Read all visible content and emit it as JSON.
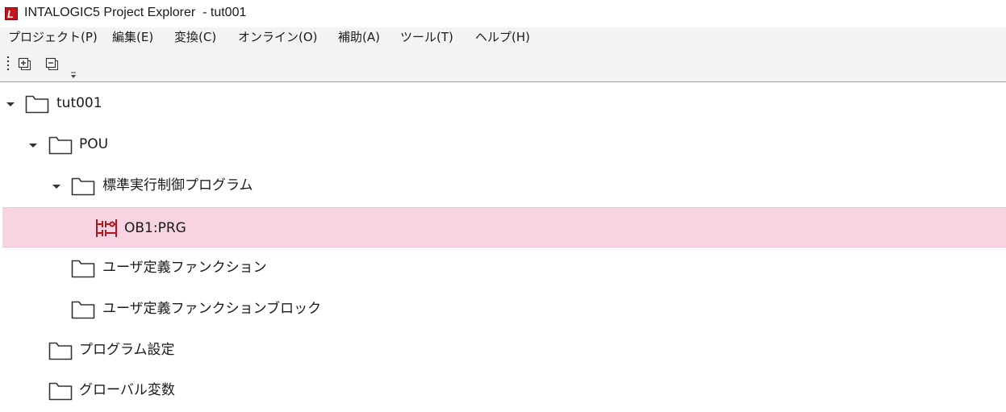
{
  "window": {
    "title": "INTALOGIC5 Project Explorer  - tut001",
    "app_icon_letter": "L"
  },
  "menubar": {
    "items": [
      {
        "label": "プロジェクト(P)"
      },
      {
        "label": "編集(E)"
      },
      {
        "label": "変換(C)"
      },
      {
        "label": "オンライン(O)"
      },
      {
        "label": "補助(A)"
      },
      {
        "label": "ツール(T)"
      },
      {
        "label": "ヘルプ(H)"
      }
    ]
  },
  "toolbar": {
    "buttons": [
      {
        "name": "expand-all-button",
        "icon": "expand-all-icon"
      },
      {
        "name": "collapse-all-button",
        "icon": "collapse-all-icon"
      }
    ],
    "overflow_icon": "toolbar-overflow-icon"
  },
  "tree": {
    "items": [
      {
        "label": "tut001",
        "level": 0,
        "expanded": true,
        "icon": "folder-icon"
      },
      {
        "label": "POU",
        "level": 1,
        "expanded": true,
        "icon": "folder-icon"
      },
      {
        "label": "標準実行制御プログラム",
        "level": 2,
        "expanded": true,
        "icon": "folder-icon"
      },
      {
        "label": "OB1:PRG",
        "level": 3,
        "icon": "ladder-program-icon",
        "selected": true
      },
      {
        "label": "ユーザ定義ファンクション",
        "level": 2,
        "icon": "folder-icon"
      },
      {
        "label": "ユーザ定義ファンクションブロック",
        "level": 2,
        "icon": "folder-icon"
      },
      {
        "label": "プログラム設定",
        "level": 1,
        "icon": "folder-icon"
      },
      {
        "label": "グローバル変数",
        "level": 1,
        "icon": "folder-icon"
      }
    ]
  },
  "colors": {
    "selection": "#f8d3e2",
    "ladder_icon": "#b3141b",
    "menubar_bg": "#f3f3f3"
  }
}
